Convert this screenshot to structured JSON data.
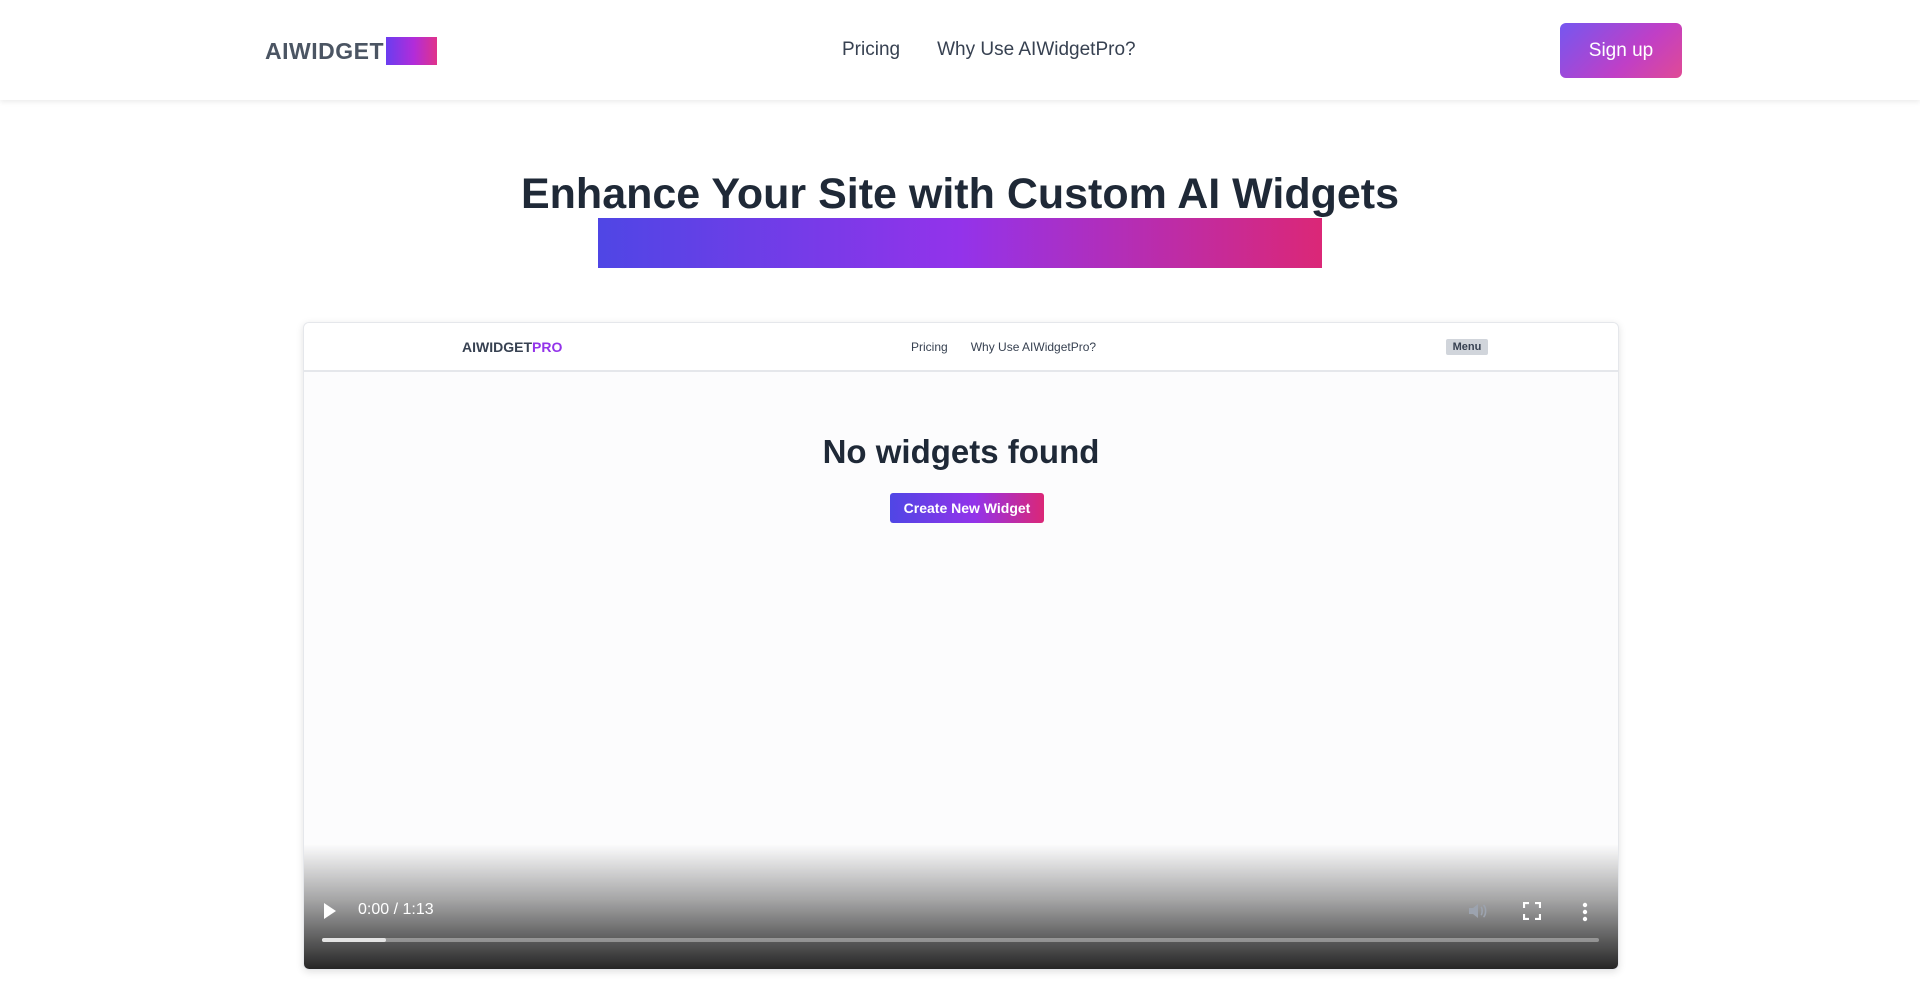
{
  "header": {
    "logo_text": "AIWIDGET",
    "nav": [
      {
        "label": "Pricing"
      },
      {
        "label": "Why Use AIWidgetPro?"
      }
    ],
    "signup_label": "Sign up"
  },
  "hero": {
    "title": "Enhance Your Site with Custom AI Widgets"
  },
  "video": {
    "inner_header": {
      "logo_main": "AIWIDGET",
      "logo_accent": "PRO",
      "nav": [
        "Pricing",
        "Why Use AIWidgetPro?"
      ],
      "menu_label": "Menu"
    },
    "empty_message": "No widgets found",
    "create_button_label": "Create New Widget",
    "time_display": "0:00 / 1:13",
    "buffered_fraction": 0.05,
    "icons": {
      "play": "play-icon",
      "volume": "volume-icon",
      "fullscreen": "fullscreen-icon",
      "more": "more-vertical-icon"
    }
  },
  "colors": {
    "gradient_start": "#4f46e5",
    "gradient_mid": "#9333ea",
    "gradient_end": "#db2777"
  }
}
